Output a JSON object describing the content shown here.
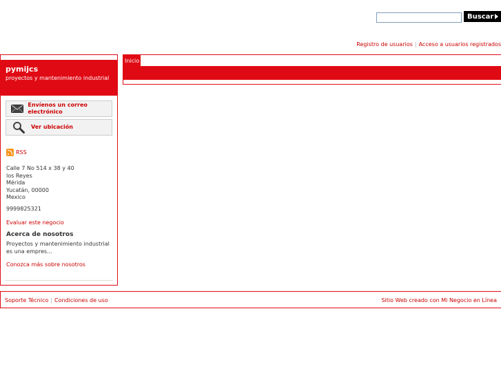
{
  "search": {
    "placeholder": "",
    "value": "",
    "button_label": "Buscar"
  },
  "user_links": {
    "register": "Registro de usuarios",
    "login": "Acceso a usuarios registrados",
    "separator": "|"
  },
  "brand": {
    "name": "pymijcs",
    "tagline": "proyectos y mantenimiento industrial"
  },
  "actions": {
    "email": {
      "label": "Envíenos un correo electrónico",
      "icon": "envelope-icon"
    },
    "location": {
      "label": "Ver ubicación",
      "icon": "magnifier-icon"
    }
  },
  "rss": {
    "label": "RSS",
    "icon": "rss-icon"
  },
  "address": {
    "street": "Calle 7 No 514 x 38 y 40",
    "neighborhood": "los Reyes",
    "city": "Mérida",
    "state_zip": "Yucatán, 00000",
    "country": "Mexico"
  },
  "phone": "9999825321",
  "rate_link": "Evaluar este negocio",
  "about": {
    "title": "Acerca de nosotros",
    "text": "Proyectos y mantenimiento industrial es una empres...",
    "more_link": "Conozca más sobre nosotros"
  },
  "tabs": [
    {
      "label": "Inicio",
      "active": true
    }
  ],
  "footer": {
    "support": "Soporte Técnico",
    "terms": "Condiciones de uso",
    "separator": "|",
    "credit": "Sitio Web creado con Mi Negocio en Línea"
  },
  "colors": {
    "accent": "#e00a14",
    "link": "#cc0000",
    "button": "#000000"
  }
}
